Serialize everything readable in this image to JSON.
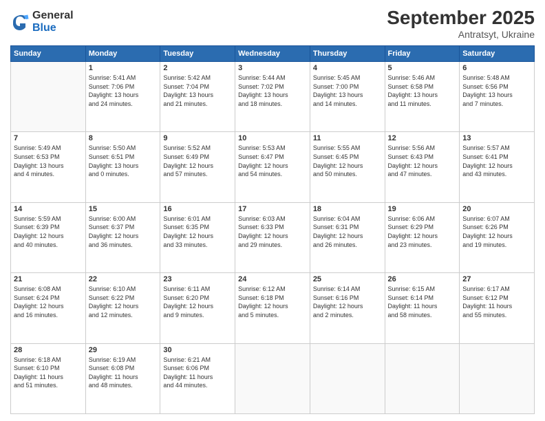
{
  "logo": {
    "general": "General",
    "blue": "Blue"
  },
  "title": "September 2025",
  "subtitle": "Antratsyt, Ukraine",
  "headers": [
    "Sunday",
    "Monday",
    "Tuesday",
    "Wednesday",
    "Thursday",
    "Friday",
    "Saturday"
  ],
  "weeks": [
    [
      {
        "day": "",
        "info": ""
      },
      {
        "day": "1",
        "info": "Sunrise: 5:41 AM\nSunset: 7:06 PM\nDaylight: 13 hours\nand 24 minutes."
      },
      {
        "day": "2",
        "info": "Sunrise: 5:42 AM\nSunset: 7:04 PM\nDaylight: 13 hours\nand 21 minutes."
      },
      {
        "day": "3",
        "info": "Sunrise: 5:44 AM\nSunset: 7:02 PM\nDaylight: 13 hours\nand 18 minutes."
      },
      {
        "day": "4",
        "info": "Sunrise: 5:45 AM\nSunset: 7:00 PM\nDaylight: 13 hours\nand 14 minutes."
      },
      {
        "day": "5",
        "info": "Sunrise: 5:46 AM\nSunset: 6:58 PM\nDaylight: 13 hours\nand 11 minutes."
      },
      {
        "day": "6",
        "info": "Sunrise: 5:48 AM\nSunset: 6:56 PM\nDaylight: 13 hours\nand 7 minutes."
      }
    ],
    [
      {
        "day": "7",
        "info": "Sunrise: 5:49 AM\nSunset: 6:53 PM\nDaylight: 13 hours\nand 4 minutes."
      },
      {
        "day": "8",
        "info": "Sunrise: 5:50 AM\nSunset: 6:51 PM\nDaylight: 13 hours\nand 0 minutes."
      },
      {
        "day": "9",
        "info": "Sunrise: 5:52 AM\nSunset: 6:49 PM\nDaylight: 12 hours\nand 57 minutes."
      },
      {
        "day": "10",
        "info": "Sunrise: 5:53 AM\nSunset: 6:47 PM\nDaylight: 12 hours\nand 54 minutes."
      },
      {
        "day": "11",
        "info": "Sunrise: 5:55 AM\nSunset: 6:45 PM\nDaylight: 12 hours\nand 50 minutes."
      },
      {
        "day": "12",
        "info": "Sunrise: 5:56 AM\nSunset: 6:43 PM\nDaylight: 12 hours\nand 47 minutes."
      },
      {
        "day": "13",
        "info": "Sunrise: 5:57 AM\nSunset: 6:41 PM\nDaylight: 12 hours\nand 43 minutes."
      }
    ],
    [
      {
        "day": "14",
        "info": "Sunrise: 5:59 AM\nSunset: 6:39 PM\nDaylight: 12 hours\nand 40 minutes."
      },
      {
        "day": "15",
        "info": "Sunrise: 6:00 AM\nSunset: 6:37 PM\nDaylight: 12 hours\nand 36 minutes."
      },
      {
        "day": "16",
        "info": "Sunrise: 6:01 AM\nSunset: 6:35 PM\nDaylight: 12 hours\nand 33 minutes."
      },
      {
        "day": "17",
        "info": "Sunrise: 6:03 AM\nSunset: 6:33 PM\nDaylight: 12 hours\nand 29 minutes."
      },
      {
        "day": "18",
        "info": "Sunrise: 6:04 AM\nSunset: 6:31 PM\nDaylight: 12 hours\nand 26 minutes."
      },
      {
        "day": "19",
        "info": "Sunrise: 6:06 AM\nSunset: 6:29 PM\nDaylight: 12 hours\nand 23 minutes."
      },
      {
        "day": "20",
        "info": "Sunrise: 6:07 AM\nSunset: 6:26 PM\nDaylight: 12 hours\nand 19 minutes."
      }
    ],
    [
      {
        "day": "21",
        "info": "Sunrise: 6:08 AM\nSunset: 6:24 PM\nDaylight: 12 hours\nand 16 minutes."
      },
      {
        "day": "22",
        "info": "Sunrise: 6:10 AM\nSunset: 6:22 PM\nDaylight: 12 hours\nand 12 minutes."
      },
      {
        "day": "23",
        "info": "Sunrise: 6:11 AM\nSunset: 6:20 PM\nDaylight: 12 hours\nand 9 minutes."
      },
      {
        "day": "24",
        "info": "Sunrise: 6:12 AM\nSunset: 6:18 PM\nDaylight: 12 hours\nand 5 minutes."
      },
      {
        "day": "25",
        "info": "Sunrise: 6:14 AM\nSunset: 6:16 PM\nDaylight: 12 hours\nand 2 minutes."
      },
      {
        "day": "26",
        "info": "Sunrise: 6:15 AM\nSunset: 6:14 PM\nDaylight: 11 hours\nand 58 minutes."
      },
      {
        "day": "27",
        "info": "Sunrise: 6:17 AM\nSunset: 6:12 PM\nDaylight: 11 hours\nand 55 minutes."
      }
    ],
    [
      {
        "day": "28",
        "info": "Sunrise: 6:18 AM\nSunset: 6:10 PM\nDaylight: 11 hours\nand 51 minutes."
      },
      {
        "day": "29",
        "info": "Sunrise: 6:19 AM\nSunset: 6:08 PM\nDaylight: 11 hours\nand 48 minutes."
      },
      {
        "day": "30",
        "info": "Sunrise: 6:21 AM\nSunset: 6:06 PM\nDaylight: 11 hours\nand 44 minutes."
      },
      {
        "day": "",
        "info": ""
      },
      {
        "day": "",
        "info": ""
      },
      {
        "day": "",
        "info": ""
      },
      {
        "day": "",
        "info": ""
      }
    ]
  ]
}
